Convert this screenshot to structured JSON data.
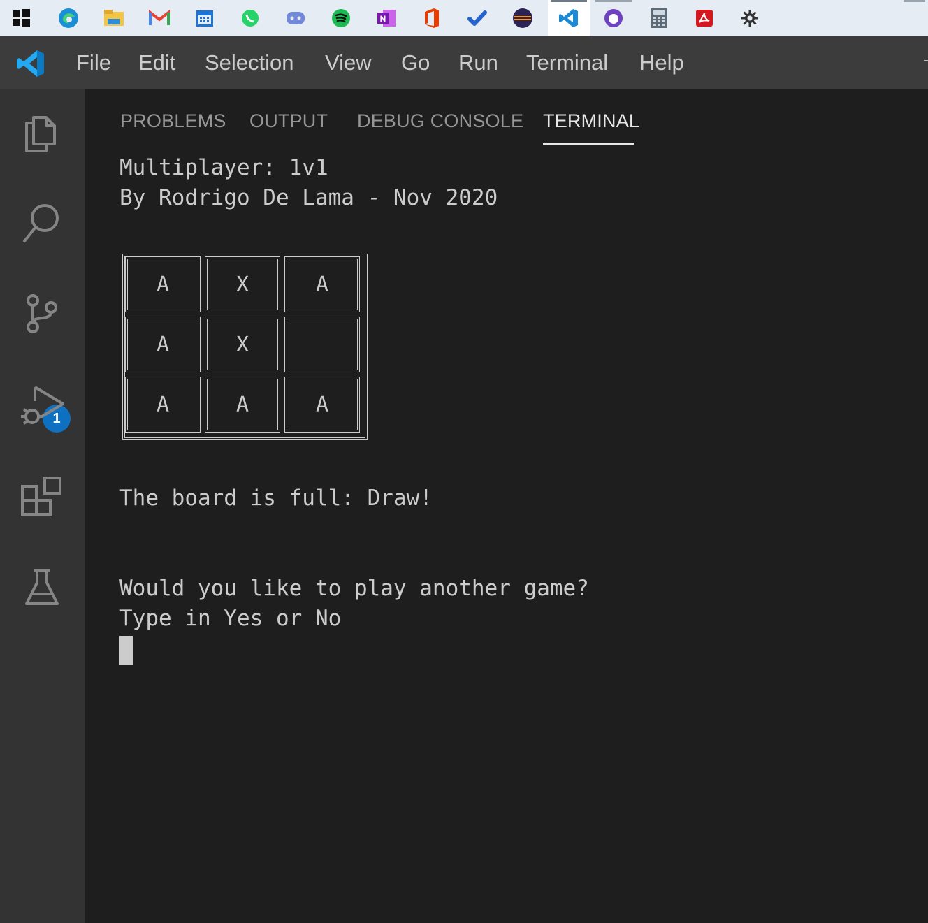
{
  "taskbar": {
    "icons": [
      "windows-start-icon",
      "edge-icon",
      "file-explorer-icon",
      "gmail-icon",
      "calendar-icon",
      "whatsapp-icon",
      "discord-icon",
      "spotify-icon",
      "onenote-icon",
      "office-icon",
      "todo-icon",
      "eclipse-icon",
      "vscode-icon",
      "github-desktop-icon",
      "calculator-icon",
      "acrobat-icon",
      "settings-icon"
    ]
  },
  "menu": {
    "file": "File",
    "edit": "Edit",
    "selection": "Selection",
    "view": "View",
    "go": "Go",
    "run": "Run",
    "terminal": "Terminal",
    "help": "Help"
  },
  "activity": {
    "scm_badge": "1"
  },
  "panel": {
    "tabs": [
      "PROBLEMS",
      "OUTPUT",
      "DEBUG CONSOLE",
      "TERMINAL"
    ],
    "active_tab": "TERMINAL"
  },
  "terminal": {
    "line1": "Multiplayer: 1v1",
    "line2": "By Rodrigo De Lama - Nov 2020",
    "board": [
      [
        "A",
        "X",
        "A"
      ],
      [
        "A",
        "X",
        ""
      ],
      [
        "A",
        "A",
        "A"
      ]
    ],
    "result": "The board is full: Draw!",
    "prompt1": "Would you like to play another game?",
    "prompt2": "Type in Yes or No"
  },
  "colors": {
    "background": "#1e1e1e",
    "menubar": "#3c3c3c",
    "activitybar": "#333333",
    "badge": "#0e70c0",
    "text": "#cccccc"
  }
}
